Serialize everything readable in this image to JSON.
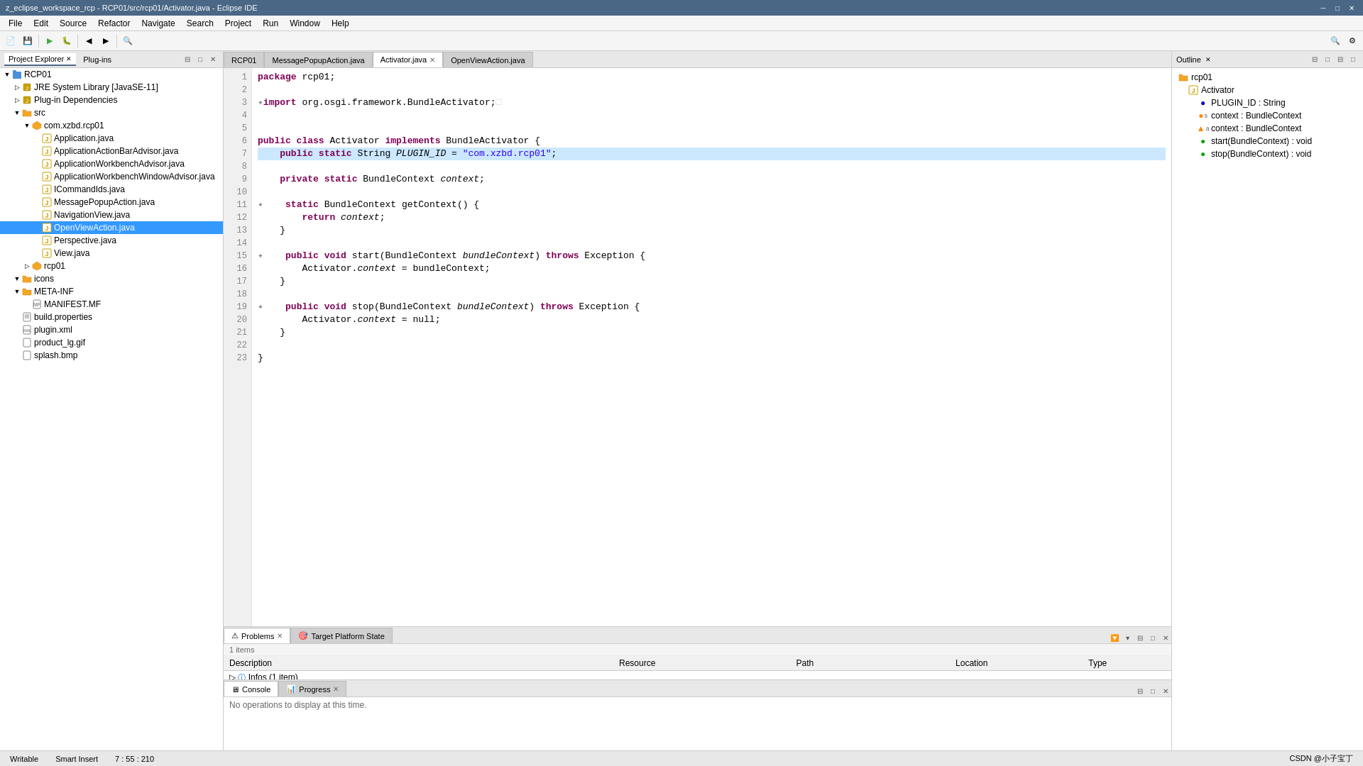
{
  "titleBar": {
    "title": "z_eclipse_workspace_rcp - RCP01/src/rcp01/Activator.java - Eclipse IDE",
    "minimize": "─",
    "maximize": "□",
    "close": "✕"
  },
  "menuBar": {
    "items": [
      "File",
      "Edit",
      "Source",
      "Refactor",
      "Navigate",
      "Search",
      "Project",
      "Run",
      "Window",
      "Help"
    ]
  },
  "leftPanel": {
    "tabs": [
      {
        "label": "Project Explorer",
        "active": true
      },
      {
        "label": "Plug-ins",
        "active": false
      }
    ],
    "tree": [
      {
        "indent": 0,
        "toggle": "▼",
        "icon": "📁",
        "label": "RCP01",
        "type": "project"
      },
      {
        "indent": 1,
        "toggle": "▷",
        "icon": "☕",
        "label": "JRE System Library [JavaSE-11]",
        "type": "library"
      },
      {
        "indent": 1,
        "toggle": "▷",
        "icon": "📦",
        "label": "Plug-in Dependencies",
        "type": "library"
      },
      {
        "indent": 1,
        "toggle": "▼",
        "icon": "📁",
        "label": "src",
        "type": "folder"
      },
      {
        "indent": 2,
        "toggle": "▼",
        "icon": "📦",
        "label": "com.xzbd.rcp01",
        "type": "package"
      },
      {
        "indent": 3,
        "toggle": "",
        "icon": "☕",
        "label": "Application.java",
        "type": "java"
      },
      {
        "indent": 3,
        "toggle": "",
        "icon": "☕",
        "label": "ApplicationActionBarAdvisor.java",
        "type": "java"
      },
      {
        "indent": 3,
        "toggle": "",
        "icon": "☕",
        "label": "ApplicationWorkbenchAdvisor.java",
        "type": "java"
      },
      {
        "indent": 3,
        "toggle": "",
        "icon": "☕",
        "label": "ApplicationWorkbenchWindowAdvisor.java",
        "type": "java"
      },
      {
        "indent": 3,
        "toggle": "",
        "icon": "☕",
        "label": "ICommandIds.java",
        "type": "java"
      },
      {
        "indent": 3,
        "toggle": "",
        "icon": "☕",
        "label": "MessagePopupAction.java",
        "type": "java"
      },
      {
        "indent": 3,
        "toggle": "",
        "icon": "☕",
        "label": "NavigationView.java",
        "type": "java"
      },
      {
        "indent": 3,
        "toggle": "",
        "icon": "☕",
        "label": "OpenViewAction.java",
        "type": "java",
        "selected": true
      },
      {
        "indent": 3,
        "toggle": "",
        "icon": "☕",
        "label": "Perspective.java",
        "type": "java"
      },
      {
        "indent": 3,
        "toggle": "",
        "icon": "☕",
        "label": "View.java",
        "type": "java"
      },
      {
        "indent": 2,
        "toggle": "▷",
        "icon": "📦",
        "label": "rcp01",
        "type": "package"
      },
      {
        "indent": 1,
        "toggle": "▼",
        "icon": "🖼",
        "label": "icons",
        "type": "folder"
      },
      {
        "indent": 1,
        "toggle": "▼",
        "icon": "📁",
        "label": "META-INF",
        "type": "folder"
      },
      {
        "indent": 2,
        "toggle": "",
        "icon": "📄",
        "label": "MANIFEST.MF",
        "type": "file"
      },
      {
        "indent": 1,
        "toggle": "",
        "icon": "⚙",
        "label": "build.properties",
        "type": "file"
      },
      {
        "indent": 1,
        "toggle": "",
        "icon": "🔌",
        "label": "plugin.xml",
        "type": "file"
      },
      {
        "indent": 1,
        "toggle": "",
        "icon": "🌐",
        "label": "product_lg.gif",
        "type": "file"
      },
      {
        "indent": 1,
        "toggle": "",
        "icon": "🖼",
        "label": "splash.bmp",
        "type": "file"
      }
    ]
  },
  "editorTabs": [
    {
      "label": "RCP01",
      "active": false,
      "closable": false
    },
    {
      "label": "MessagePopupAction.java",
      "active": false,
      "closable": false
    },
    {
      "label": "Activator.java",
      "active": true,
      "closable": true
    },
    {
      "label": "OpenViewAction.java",
      "active": false,
      "closable": false
    }
  ],
  "codeLines": [
    {
      "num": 1,
      "content": "package rcp01;",
      "highlight": false
    },
    {
      "num": 2,
      "content": "",
      "highlight": false
    },
    {
      "num": 3,
      "content": "import org.osgi.framework.BundleActivator;",
      "highlight": false,
      "hasIcon": true
    },
    {
      "num": 4,
      "content": "",
      "highlight": false
    },
    {
      "num": 5,
      "content": "",
      "highlight": false
    },
    {
      "num": 6,
      "content": "public class Activator implements BundleActivator {",
      "highlight": false
    },
    {
      "num": 7,
      "content": "    public static String PLUGIN_ID = \"com.xzbd.rcp01\";",
      "highlight": true
    },
    {
      "num": 8,
      "content": "",
      "highlight": false
    },
    {
      "num": 9,
      "content": "    private static BundleContext context;",
      "highlight": false
    },
    {
      "num": 10,
      "content": "",
      "highlight": false
    },
    {
      "num": 11,
      "content": "    static BundleContext getContext() {",
      "highlight": false,
      "hasIcon": true
    },
    {
      "num": 12,
      "content": "        return context;",
      "highlight": false
    },
    {
      "num": 13,
      "content": "    }",
      "highlight": false
    },
    {
      "num": 14,
      "content": "",
      "highlight": false
    },
    {
      "num": 15,
      "content": "    public void start(BundleContext bundleContext) throws Exception {",
      "highlight": false,
      "hasIcon": true
    },
    {
      "num": 16,
      "content": "        Activator.context = bundleContext;",
      "highlight": false
    },
    {
      "num": 17,
      "content": "    }",
      "highlight": false
    },
    {
      "num": 18,
      "content": "",
      "highlight": false
    },
    {
      "num": 19,
      "content": "    public void stop(BundleContext bundleContext) throws Exception {",
      "highlight": false,
      "hasIcon": true
    },
    {
      "num": 20,
      "content": "        Activator.context = null;",
      "highlight": false
    },
    {
      "num": 21,
      "content": "    }",
      "highlight": false
    },
    {
      "num": 22,
      "content": "",
      "highlight": false
    },
    {
      "num": 23,
      "content": "}",
      "highlight": false
    }
  ],
  "bottomPanel": {
    "tabs": [
      {
        "label": "Problems",
        "active": true,
        "closable": true,
        "icon": "⚠"
      },
      {
        "label": "Target Platform State",
        "active": false,
        "closable": false,
        "icon": "🎯"
      }
    ],
    "problemsCount": "1 items",
    "tableHeaders": [
      "Description",
      "Resource",
      "Path",
      "Location",
      "Type"
    ],
    "rows": [
      {
        "description": "Infos (1 item)",
        "resource": "",
        "path": "",
        "location": "",
        "type": "",
        "isGroup": true
      }
    ]
  },
  "consolePanel": {
    "tabs": [
      {
        "label": "Console",
        "active": true,
        "closable": false,
        "icon": "🖥"
      },
      {
        "label": "Progress",
        "active": false,
        "closable": true,
        "icon": "📊"
      }
    ],
    "message": "No operations to display at this time."
  },
  "outlinePanel": {
    "title": "Outline",
    "items": [
      {
        "indent": 0,
        "icon": "📁",
        "label": "rcp01",
        "color": "blue"
      },
      {
        "indent": 1,
        "icon": "☕",
        "label": "Activator",
        "color": "green"
      },
      {
        "indent": 2,
        "dot": "●",
        "dotColor": "blue",
        "label": "PLUGIN_ID : String"
      },
      {
        "indent": 2,
        "dot": "●",
        "dotColor": "orange",
        "label": "context : BundleContext",
        "prefix": "s"
      },
      {
        "indent": 2,
        "dot": "▲",
        "dotColor": "orange",
        "label": "context : BundleContext",
        "prefix": "a"
      },
      {
        "indent": 2,
        "dot": "●",
        "dotColor": "green",
        "label": "start(BundleContext) : void"
      },
      {
        "indent": 2,
        "dot": "●",
        "dotColor": "green",
        "label": "stop(BundleContext) : void"
      }
    ]
  },
  "statusBar": {
    "writable": "Writable",
    "insertMode": "Smart Insert",
    "position": "7 : 55 : 210",
    "watermark": "CSDN @小子宝丁"
  }
}
